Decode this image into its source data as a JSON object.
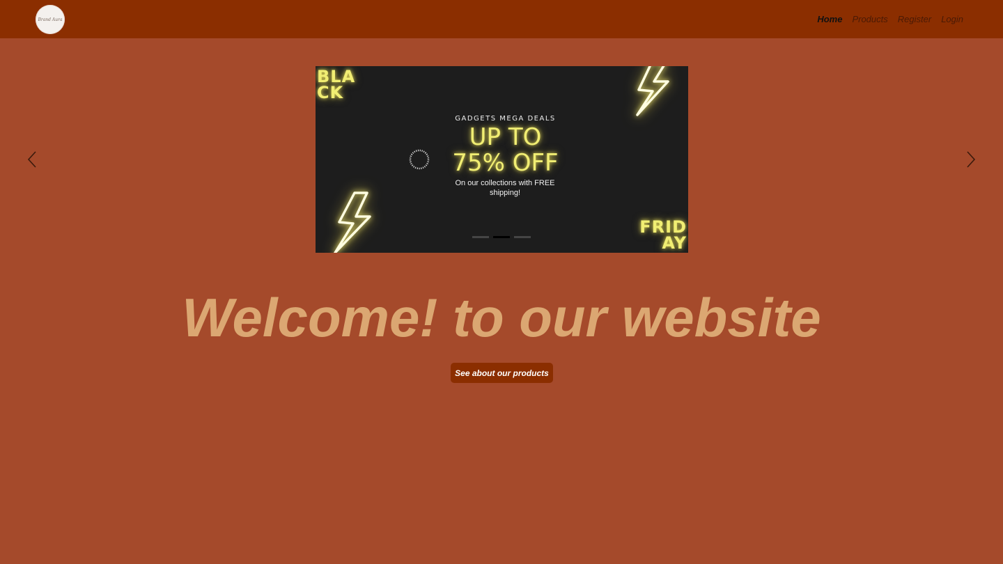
{
  "logo": {
    "text": "Brand Aura",
    "icon": "logo-badge"
  },
  "nav": {
    "items": [
      {
        "label": "Home",
        "active": true
      },
      {
        "label": "Products",
        "active": false
      },
      {
        "label": "Register",
        "active": false
      },
      {
        "label": "Login",
        "active": false
      }
    ]
  },
  "carousel": {
    "prev_icon": "chevron-left-icon",
    "next_icon": "chevron-right-icon",
    "active_slide": 2,
    "slide_count": 3,
    "slide": {
      "word_top_line1": "BLA",
      "word_top_line2": "CK",
      "word_bottom_line1": "FRID",
      "word_bottom_line2": "AY",
      "kicker": "GADGETS MEGA DEALS",
      "headline_line1": "UP TO",
      "headline_line2": "75% OFF",
      "subtext": "On our collections with FREE shipping!",
      "ring_text": "GADGET MEGA SALE UP TO 75% ·"
    }
  },
  "hero": {
    "heading": "Welcome! to our website",
    "cta_label": "See about our products"
  },
  "colors": {
    "page_bg": "#a54a2b",
    "navbar_bg": "#8b2e00",
    "heading": "#dba772",
    "neon_yellow": "#f1ee73",
    "slide_bg": "#1d1d1d"
  }
}
